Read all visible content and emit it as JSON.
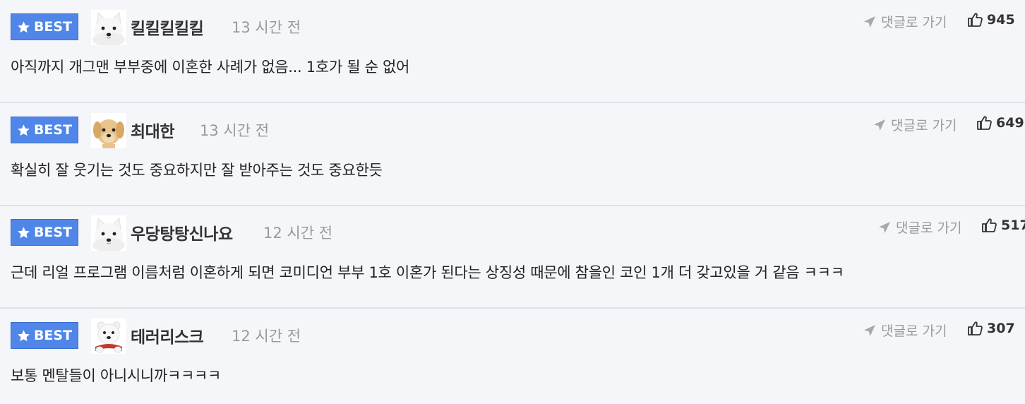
{
  "comments": [
    {
      "badge": "BEST",
      "username": "킬킬킬킬킬",
      "time": "13 시간 전",
      "goto_label": "댓글로 가기",
      "likes": "945",
      "text": "아직까지 개그맨 부부중에 이혼한 사례가 없음... 1호가 될 순 없어",
      "avatar": "white-dog-icon"
    },
    {
      "badge": "BEST",
      "username": "최대한",
      "time": "13 시간 전",
      "goto_label": "댓글로 가기",
      "likes": "649",
      "text": "확실히 잘 웃기는 것도 중요하지만 잘 받아주는 것도 중요한듯",
      "avatar": "puppy-icon"
    },
    {
      "badge": "BEST",
      "username": "우당탕탕신나요",
      "time": "12 시간 전",
      "goto_label": "댓글로 가기",
      "likes": "517",
      "text": "근데 리얼 프로그램 이름처럼 이혼하게 되면 코미디언 부부 1호 이혼가 된다는 상징성 때문에 참을인 코인 1개 더 갖고있을 거 같음 ㅋㅋㅋ",
      "avatar": "white-dog-icon"
    },
    {
      "badge": "BEST",
      "username": "테러리스크",
      "time": "12 시간 전",
      "goto_label": "댓글로 가기",
      "likes": "307",
      "text": "보통 멘탈들이 아니시니까ㅋㅋㅋㅋ",
      "avatar": "white-bear-icon"
    }
  ],
  "colors": {
    "badge": "#4f86e8",
    "background": "#f5f6fa",
    "divider": "#dfe1e6",
    "muted": "#9a9a9a"
  }
}
